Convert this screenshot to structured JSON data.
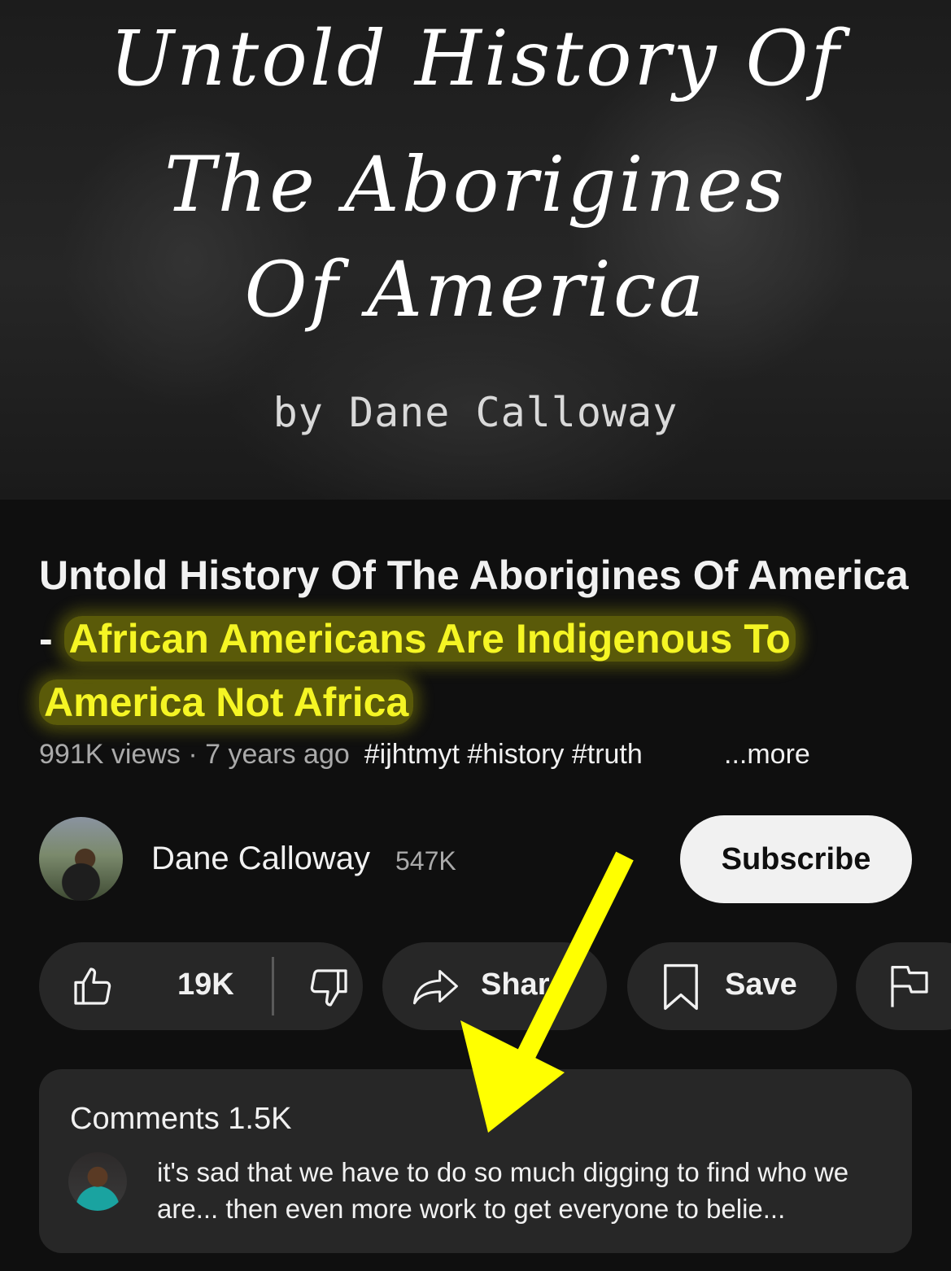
{
  "thumbnail": {
    "title_line1": "Untold History Of",
    "title_line2": "The Aborigines",
    "title_line3": "Of America",
    "byline": "by Dane Calloway"
  },
  "video": {
    "title_plain": "Untold History Of The Aborigines Of America - ",
    "title_highlight": "African Americans Are Indigenous To America Not Africa",
    "highlight_color": "#f5f524",
    "views": "991K views",
    "separator": " · ",
    "age": "7 years ago",
    "hashtags": "#ijhtmyt #history #truth",
    "more_label": "...more"
  },
  "channel": {
    "name": "Dane Calloway",
    "subscribers": "547K",
    "subscribe_label": "Subscribe"
  },
  "actions": {
    "like_count": "19K",
    "share_label": "Share",
    "save_label": "Save"
  },
  "comments": {
    "header": "Comments 1.5K",
    "top_comment": "it's sad that we have to do so much digging to find who we are... then even more work to get everyone to belie..."
  },
  "annotation": {
    "arrow_color": "#ffff00"
  }
}
